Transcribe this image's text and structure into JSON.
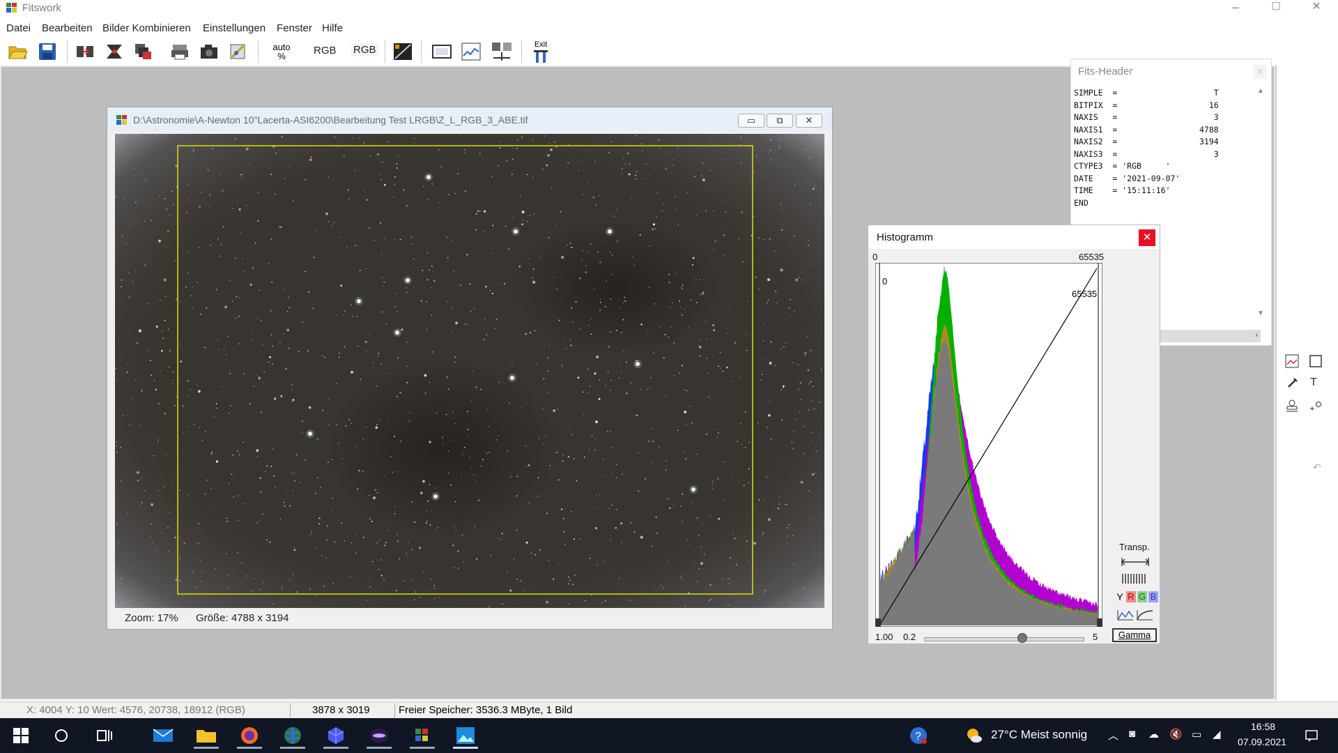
{
  "app": {
    "title": "Fitswork"
  },
  "window_controls": {
    "minimize": "–",
    "maximize": "☐",
    "close": "✕"
  },
  "menu": [
    "Datei",
    "Bearbeiten",
    "Bilder Kombinieren",
    "Einstellungen",
    "Fenster",
    "Hilfe"
  ],
  "toolbar": {
    "auto_label_top": "auto",
    "auto_label_bottom": "%",
    "rgb1": "RGB",
    "rgb2": "RGB",
    "exit": "Exit",
    "icons": [
      "open-folder-icon",
      "save-disk-icon",
      "align-icon",
      "stack-icon",
      "multi-image-icon",
      "print-icon",
      "camera-icon",
      "satellite-icon",
      "auto-percent",
      "rgb-icon",
      "rgb-icon",
      "levels-icon",
      "window-icon",
      "graph-icon",
      "measure-icon",
      "exit-icon"
    ]
  },
  "image_window": {
    "title": "D:\\Astronomie\\A-Newton 10\"Lacerta-ASI6200\\Bearbeitung Test LRGB\\Z_L_RGB_3_ABE.tif",
    "zoom": "Zoom: 17%",
    "size": "Größe: 4788 x 3194",
    "crop_color": "#e3e000"
  },
  "fits_header": {
    "title": "Fits-Header",
    "lines": [
      "SIMPLE  =                    T",
      "BITPIX  =                   16",
      "NAXIS   =                    3",
      "NAXIS1  =                 4788",
      "NAXIS2  =                 3194",
      "NAXIS3  =                    3",
      "CTYPE3  = 'RGB     '",
      "DATE    = '2021-09-07'",
      "TIME    = '15:11:16'",
      "END"
    ]
  },
  "histogram": {
    "title": "Histogramm",
    "min_label": "0",
    "max_label": "65535",
    "inner_min": "0",
    "inner_max": "65535",
    "transp": "Transp.",
    "channels": [
      "Y",
      "R",
      "G",
      "B"
    ],
    "gamma_value": "1.00",
    "slider_min": "0.2",
    "slider_max": "5",
    "gamma_button": "Gamma",
    "gamma_fraction": 0.62
  },
  "status_bar": {
    "coords": "X: 4004  Y: 10  Wert: 4576, 20738, 18912 (RGB)",
    "selection": "3878 x 3019",
    "memory": "Freier Speicher: 3536.3 MByte, 1 Bild"
  },
  "taskbar": {
    "weather": "27°C  Meist sonnig",
    "time": "16:58",
    "date": "07.09.2021"
  }
}
